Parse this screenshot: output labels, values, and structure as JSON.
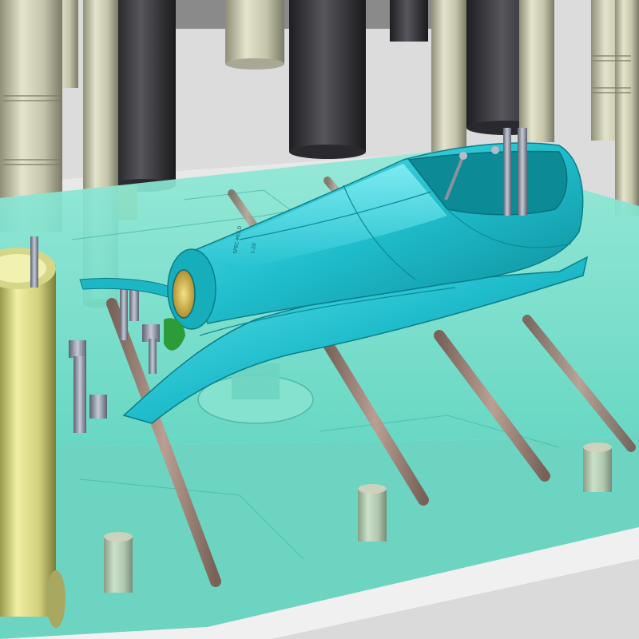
{
  "scene": {
    "description_free": true,
    "part_markings": [
      "SPEC-MOLD",
      "1-20"
    ],
    "colors": {
      "background": "#e6e6e6",
      "mold_plate": "#74e0cc",
      "fin_part": "#22c4d2",
      "fin_dark": "#0e8f9c",
      "cooling_rod": "#b07c72",
      "cylinder_light": "#dcdcc4",
      "cylinder_dark": "#3c3c40",
      "pin": "#9aa0b0",
      "frame": "#efefef"
    }
  }
}
